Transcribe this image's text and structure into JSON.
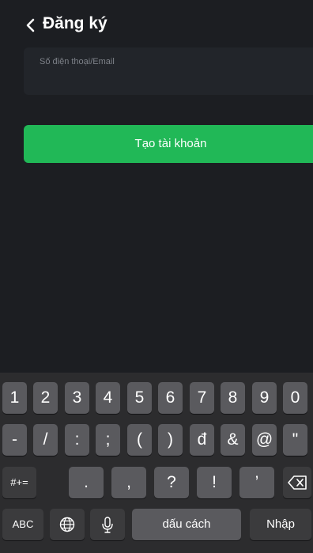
{
  "header": {
    "title": "Đăng ký",
    "back_icon": "chevron-left-icon"
  },
  "form": {
    "phone_email": {
      "label": "Số điện thoại/Email",
      "value": "",
      "placeholder": ""
    },
    "submit_label": "Tạo tài khoản"
  },
  "colors": {
    "background": "#1c1e22",
    "input_bg": "#22252a",
    "accent": "#21b857",
    "keyboard_bg": "#2c2c2e",
    "key_bg": "#5a5a5e",
    "key_dark_bg": "#3b3b3d"
  },
  "keyboard": {
    "row1": [
      "1",
      "2",
      "3",
      "4",
      "5",
      "6",
      "7",
      "8",
      "9",
      "0"
    ],
    "row2": [
      "-",
      "/",
      ":",
      ";",
      "(",
      ")",
      "đ",
      "&",
      "@",
      "\""
    ],
    "row3": [
      ".",
      ",",
      "?",
      "!",
      "’"
    ],
    "row3_shift": "#+=",
    "row4": {
      "abc": "ABC",
      "space": "dấu cách",
      "return": "Nhập"
    },
    "icons": {
      "delete": "backspace-icon",
      "globe": "globe-icon",
      "mic": "microphone-icon"
    }
  }
}
